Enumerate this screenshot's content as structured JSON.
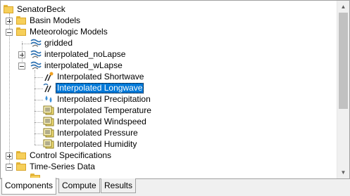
{
  "tree": {
    "root": "SenatorBeck",
    "basin_models": "Basin Models",
    "meteorologic_models": "Meteorologic Models",
    "gridded": "gridded",
    "interp_nolapse": "interpolated_noLapse",
    "interp_wlapse": "interpolated_wLapse",
    "children": [
      "Interpolated Shortwave",
      "Interpolated Longwave",
      "Interpolated Precipitation",
      "Interpolated Temperature",
      "Interpolated Windspeed",
      "Interpolated Pressure",
      "Interpolated Humidity"
    ],
    "selected": "Interpolated Longwave",
    "control_specs": "Control Specifications",
    "time_series": "Time-Series Data"
  },
  "tabs": [
    "Components",
    "Compute",
    "Results"
  ],
  "active_tab": "Components",
  "colors": {
    "selection": "#0078d7",
    "folder": "#f6cf5a"
  }
}
